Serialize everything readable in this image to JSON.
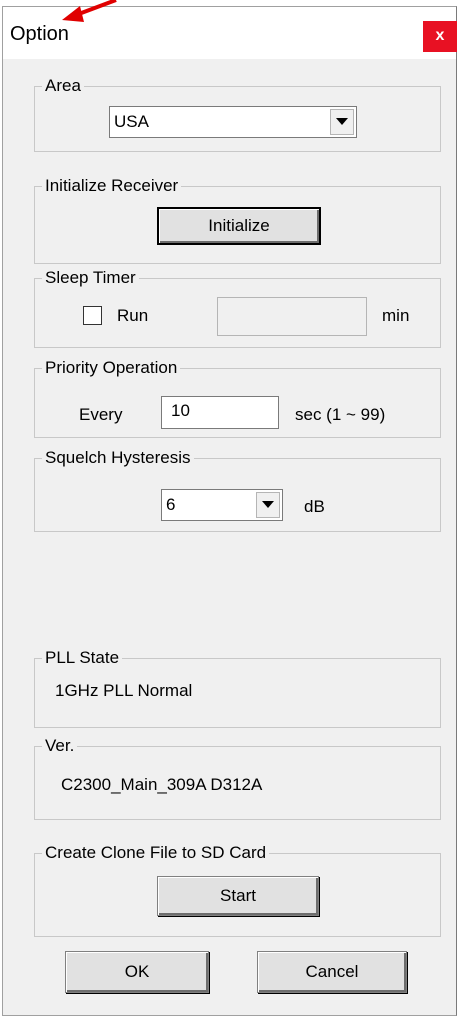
{
  "window": {
    "title": "Option",
    "close_label": "x"
  },
  "area": {
    "legend": "Area",
    "selected": "USA"
  },
  "initialize": {
    "legend": "Initialize Receiver",
    "button": "Initialize"
  },
  "sleep_timer": {
    "legend": "Sleep Timer",
    "checkbox_label": "Run",
    "value": "",
    "unit": "min"
  },
  "priority": {
    "legend": "Priority Operation",
    "prefix": "Every",
    "value": "10",
    "unit": "sec (1 ~ 99)"
  },
  "squelch": {
    "legend": "Squelch Hysteresis",
    "selected": "6",
    "unit": "dB"
  },
  "pll": {
    "legend": "PLL State",
    "value": "1GHz PLL Normal"
  },
  "version": {
    "legend": "Ver.",
    "value": "C2300_Main_309A D312A"
  },
  "clone": {
    "legend": "Create Clone File to SD Card",
    "button": "Start"
  },
  "footer": {
    "ok": "OK",
    "cancel": "Cancel"
  },
  "colors": {
    "close_bg": "#e81123",
    "dialog_bg": "#f0f0f0",
    "annotation_arrow": "#e00000"
  }
}
